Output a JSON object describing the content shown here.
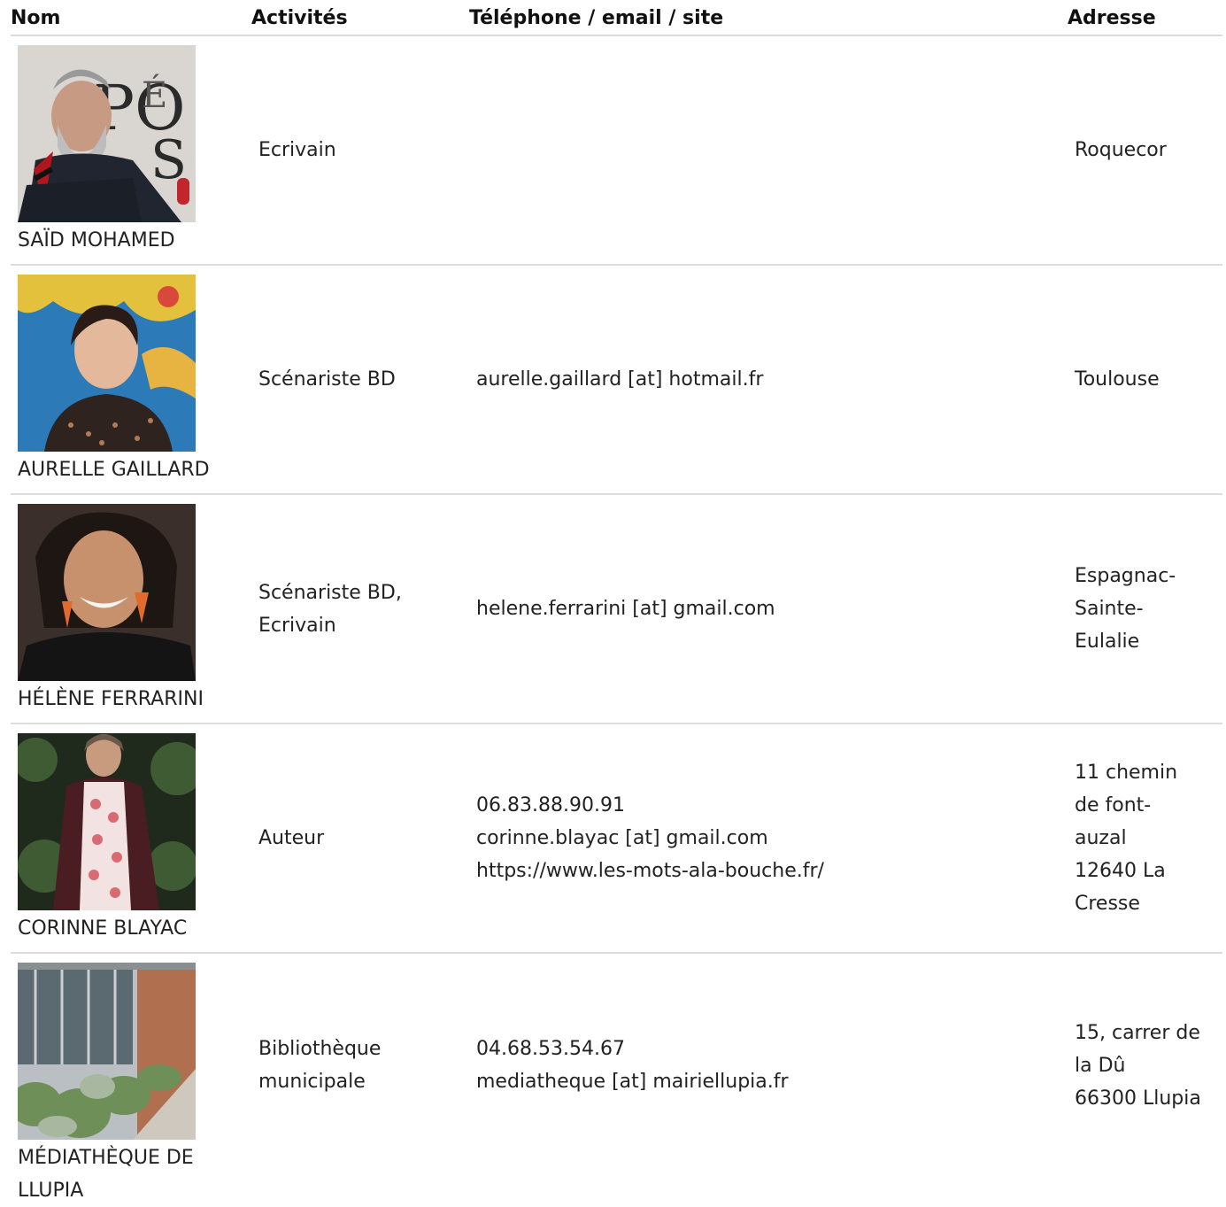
{
  "columns": {
    "name": "Nom",
    "activities": "Activités",
    "contact": "Téléphone / email / site",
    "address": "Adresse"
  },
  "rows": [
    {
      "name": "SAÏD MOHAMED",
      "activities": "Ecrivain",
      "contact": [],
      "address": [
        "Roquecor"
      ],
      "photo": "portrait of bearded man speaking at a microphone"
    },
    {
      "name": "AURELLE GAILLARD",
      "activities": "Scénariste BD",
      "contact": [
        "aurelle.gaillard [at] hotmail.fr"
      ],
      "address": [
        "Toulouse"
      ],
      "photo": "portrait of young woman looking up, blue painted background"
    },
    {
      "name": "HÉLÈNE FERRARINI",
      "activities": "Scénariste BD, Ecrivain",
      "contact": [
        "helene.ferrarini [at] gmail.com"
      ],
      "address": [
        "Espagnac-",
        "Sainte-",
        "Eulalie"
      ],
      "photo": "portrait of smiling woman with colorful earrings"
    },
    {
      "name": "CORINNE BLAYAC",
      "activities": "Auteur",
      "contact": [
        "06.83.88.90.91",
        "corinne.blayac [at] gmail.com",
        "https://www.les-mots-ala-bouche.fr/"
      ],
      "address": [
        "11 chemin",
        "de font-",
        "auzal",
        "12640 La",
        "Cresse"
      ],
      "photo": "woman in floral blouse standing in front of foliage"
    },
    {
      "name": "MÉDIATHÈQUE DE LLUPIA",
      "activities": "Bibliothèque municipale",
      "contact": [
        "04.68.53.54.67",
        "mediatheque [at] mairiellupia.fr"
      ],
      "address": [
        "15, carrer de",
        "la Dû",
        "66300 Llupia"
      ],
      "photo": "library building with glass facade and lavender garden"
    }
  ],
  "colors": {
    "divider": "#dcdcdc",
    "text": "#222222",
    "header_text": "#111111"
  }
}
